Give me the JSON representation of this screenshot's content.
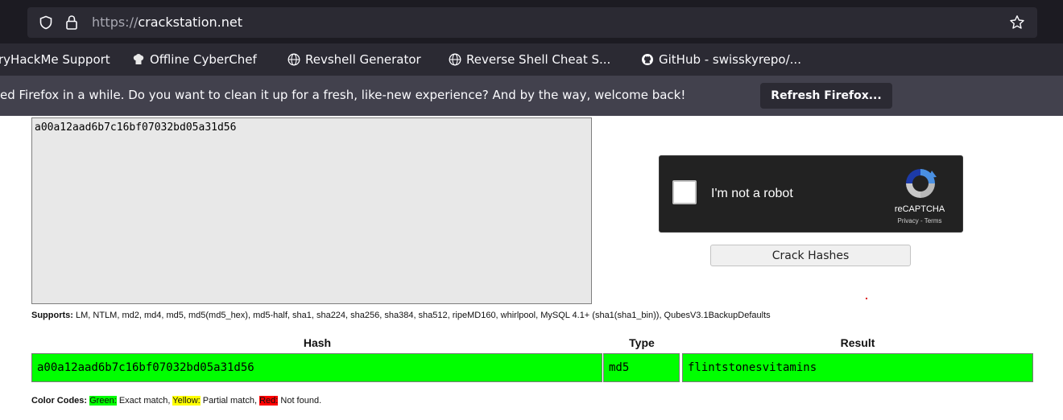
{
  "browser": {
    "url_protocol": "https://",
    "url_host": "crackstation.net",
    "bookmarks": [
      {
        "label": "ryHackMe Support",
        "icon": "none"
      },
      {
        "label": "Offline CyberChef",
        "icon": "chef-hat-icon"
      },
      {
        "label": "Revshell Generator",
        "icon": "globe-icon"
      },
      {
        "label": "Reverse Shell Cheat S...",
        "icon": "globe-icon"
      },
      {
        "label": "GitHub - swisskyrepo/...",
        "icon": "github-icon"
      }
    ],
    "notification": {
      "text": "ed Firefox in a while. Do you want to clean it up for a fresh, like-new experience? And by the way, welcome back!",
      "button": "Refresh Firefox..."
    }
  },
  "form": {
    "hash_input": "a00a12aad6b7c16bf07032bd05a31d56",
    "recaptcha": {
      "label": "I'm not a robot",
      "brand": "reCAPTCHA",
      "links": "Privacy - Terms"
    },
    "submit_label": "Crack Hashes"
  },
  "supports": {
    "label": "Supports:",
    "text": " LM, NTLM, md2, md4, md5, md5(md5_hex), md5-half, sha1, sha224, sha256, sha384, sha512, ripeMD160, whirlpool, MySQL 4.1+ (sha1(sha1_bin)), QubesV3.1BackupDefaults"
  },
  "results": {
    "headers": {
      "hash": "Hash",
      "type": "Type",
      "result": "Result"
    },
    "rows": [
      {
        "hash": "a00a12aad6b7c16bf07032bd05a31d56",
        "type": "md5",
        "result": "flintstonesvitamins",
        "status_color": "#00ff00"
      }
    ]
  },
  "color_codes": {
    "label": "Color Codes:",
    "green": "Green:",
    "green_desc": " Exact match, ",
    "yellow": "Yellow:",
    "yellow_desc": " Partial match, ",
    "red": "Red:",
    "red_desc": " Not found."
  }
}
